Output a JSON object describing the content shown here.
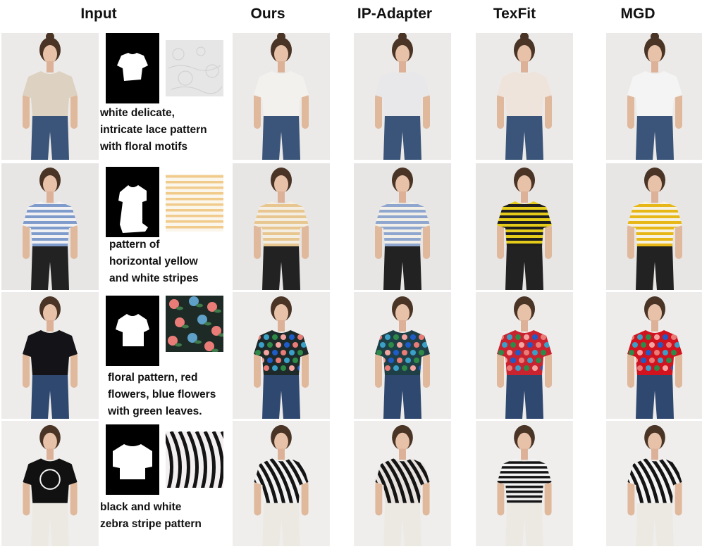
{
  "headers": {
    "input": "Input",
    "ours": "Ours",
    "ip_adapter": "IP-Adapter",
    "texfit": "TexFit",
    "mgd": "MGD"
  },
  "rows": [
    {
      "prompt": [
        "white delicate,",
        "intricate lace pattern",
        "with floral motifs"
      ],
      "colors": {
        "bg": "#eceae8",
        "input_shirt": "#ddd2c2",
        "ours_shirt": "#f3f1ee",
        "ipa_shirt": "#e8e8ea",
        "texfit_shirt": "#eee4dc",
        "mgd_shirt": "#f4f4f4",
        "pants": "#3a5579",
        "swatch": "#e4e4e4"
      }
    },
    {
      "prompt": [
        "pattern of",
        "horizontal yellow",
        "and white stripes"
      ],
      "colors": {
        "bg": "#e8e6e4",
        "input_shirt": "#f1f1f3",
        "stripe_input": "#7f9bcb",
        "ours_shirt": "#f4ede2",
        "stripe_ours": "#e8c690",
        "ipa_shirt": "#f1efe8",
        "stripe_ipa": "#8fa6cf",
        "texfit_shirt": "#e5cc1a",
        "stripe_texfit": "#1e1e1e",
        "mgd_shirt": "#f6f1e0",
        "stripe_mgd": "#e6b716",
        "pants": "#222222",
        "swatch": "#fbf6ec",
        "stripe_swatch": "#f1cb8c"
      }
    },
    {
      "prompt": [
        "floral pattern, red",
        "flowers, blue flowers",
        "with green leaves."
      ],
      "colors": {
        "bg": "#eeecea",
        "input_shirt": "#141418",
        "ours_shirt": "#1e2a2a",
        "ipa_shirt": "#1f3f46",
        "texfit_shirt": "#c8232f",
        "mgd_shirt": "#d1131f",
        "pants": "#2f4870",
        "swatch": "#1d2a26",
        "flower": "#ea7c78"
      }
    },
    {
      "prompt": [
        "black and white",
        "zebra stripe  pattern"
      ],
      "colors": {
        "bg": "#efeeec",
        "input_shirt": "#111111",
        "ours_shirt": "#f2f2f2",
        "ipa_shirt": "#e8e2de",
        "texfit_shirt": "#f4f4f4",
        "mgd_shirt": "#f4f4f4",
        "pants": "#ebe9e2",
        "swatch": "#f3eef0",
        "stripe": "#141414"
      }
    }
  ]
}
